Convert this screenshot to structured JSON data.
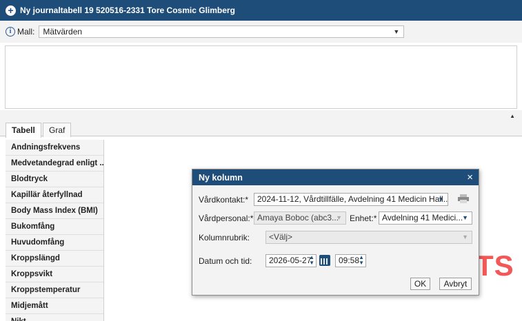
{
  "window": {
    "title": "Ny journaltabell 19 520516-2331 Tore Cosmic Glimberg",
    "title_icon": "plus-circle-icon"
  },
  "mall": {
    "label": "Mall:",
    "info_icon": "i",
    "value": "Mätvärden"
  },
  "tabs": [
    {
      "label": "Tabell",
      "active": true
    },
    {
      "label": "Graf",
      "active": false
    }
  ],
  "sidebar": {
    "items": [
      "Andningsfrekvens",
      "Medvetandegrad enligt ...",
      "Blodtryck",
      "Kapillär återfyllnad",
      "Body Mass Index (BMI)",
      "Bukomfång",
      "Huvudomfång",
      "Kroppslängd",
      "Kroppsvikt",
      "Kroppstemperatur",
      "Midjemått",
      "Nikt..."
    ]
  },
  "watermark": "TS",
  "dialog": {
    "title": "Ny kolumn",
    "close": "×",
    "vardkontakt_label": "Vårdkontakt:*",
    "vardkontakt_value": "2024-11-12, Vårdtillfälle, Avdelning 41 Medicin Hall...",
    "vardpersonal_label": "Vårdpersonal:*",
    "vardpersonal_value": "Amaya Boboc (abc3...",
    "enhet_label": "Enhet:*",
    "enhet_value": "Avdelning 41 Medici...",
    "kolumnrubrik_label": "Kolumnrubrik:",
    "kolumnrubrik_value": "<Välj>",
    "datum_label": "Datum och tid:",
    "date_value": "2026-05-27",
    "time_value": "09:58",
    "ok_label": "OK",
    "cancel_label": "Avbryt"
  },
  "colors": {
    "header_blue": "#1f4d7a",
    "watermark_red": "#f25858"
  }
}
